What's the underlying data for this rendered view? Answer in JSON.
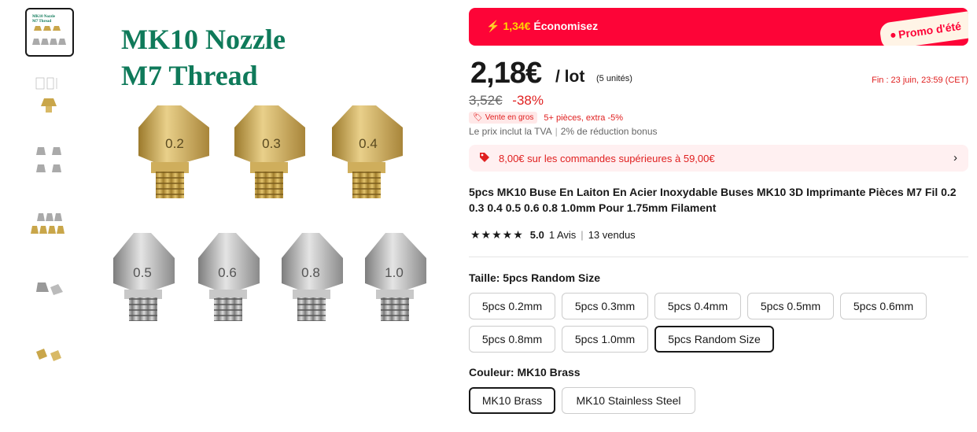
{
  "image": {
    "title_line1": "MK10 Nozzle",
    "title_line2": "M7 Thread",
    "brass_sizes": [
      "0.2",
      "0.3",
      "0.4"
    ],
    "steel_sizes": [
      "0.5",
      "0.6",
      "0.8",
      "1.0"
    ]
  },
  "thumbnails": [
    "thumb-1",
    "thumb-2",
    "thumb-3",
    "thumb-4",
    "thumb-5",
    "thumb-6"
  ],
  "promo": {
    "amount": "1,34€",
    "text": "Économisez",
    "tag": "Promo d'été"
  },
  "price": {
    "current": "2,18€",
    "per": "/ lot",
    "units": "(5 unités)",
    "end": "Fin : 23 juin, 23:59 (CET)",
    "old": "3,52€",
    "discount": "-38%"
  },
  "bulk": {
    "badge": "Vente en gros",
    "text": "5+ pièces, extra -5%"
  },
  "vat": {
    "text": "Le prix inclut la TVA",
    "bonus": "2% de réduction bonus"
  },
  "coupon": "8,00€ sur les commandes supérieures à 59,00€",
  "product_title": "5pcs MK10 Buse En Laiton En Acier Inoxydable Buses MK10 3D Imprimante Pièces M7 Fil 0.2 0.3 0.4 0.5 0.6 0.8 1.0mm Pour 1.75mm Filament",
  "rating": {
    "stars": "★★★★★",
    "score": "5.0",
    "reviews": "1 Avis",
    "sold": "13 vendus"
  },
  "size": {
    "label": "Taille: 5pcs Random Size",
    "options": [
      "5pcs 0.2mm",
      "5pcs 0.3mm",
      "5pcs 0.4mm",
      "5pcs 0.5mm",
      "5pcs 0.6mm",
      "5pcs 0.8mm",
      "5pcs 1.0mm",
      "5pcs Random Size"
    ],
    "selected": "5pcs Random Size"
  },
  "color": {
    "label": "Couleur: MK10 Brass",
    "options": [
      "MK10 Brass",
      "MK10 Stainless Steel"
    ],
    "selected": "MK10 Brass"
  },
  "colors": {
    "accent_red": "#fd0437",
    "price_red": "#e02020",
    "title_green": "#0f7a5a",
    "brass": "#c9a64a",
    "steel": "#b8b8b8"
  }
}
